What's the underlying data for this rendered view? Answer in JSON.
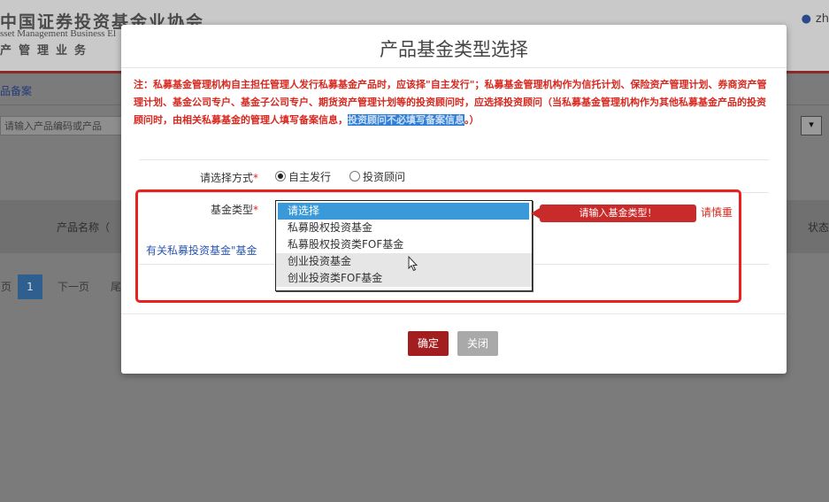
{
  "background": {
    "org_name": "中国证券投资基金业协会",
    "org_name_en": "sset Management Business El",
    "org_sub": "产管理业务",
    "user_name": "zh",
    "breadcrumb": "品备案",
    "search_placeholder": "请输入产品编码或产品",
    "select_arrow": "▾",
    "table_col_product": "产品名称（",
    "table_col_status": "状态",
    "pager": {
      "prev": "页",
      "current": "1",
      "next": "下一页",
      "last": "尾"
    }
  },
  "modal": {
    "title": "产品基金类型选择",
    "notice_text": "注：私募基金管理机构自主担任管理人发行私募基金产品时，应该择\"自主发行\"；私募基金管理机构作为信托计划、保险资产管理计划、券商资产管理计划、基金公司专户、基金子公司专户、期货资产管理计划等的投资顾问时，应选择投资顾问（当私募基金管理机构作为其他私募基金产品的投资顾问时，由相关私募基金的管理人填写备案信息，",
    "notice_highlight": "投资顾问不必填写备案信息",
    "notice_end": "。）",
    "method_label": "请选择方式",
    "required_mark": "*",
    "radio_self": "自主发行",
    "radio_advisor": "投资顾问",
    "fund_type_label": "基金类型",
    "fund_type_note": "有关私募投资基金\"基金",
    "ok_label": "确定",
    "close_label": "关闭"
  },
  "dropdown": {
    "options": [
      "请选择",
      "私募股权投资基金",
      "私募股权投资类FOF基金",
      "创业投资基金",
      "创业投资类FOF基金"
    ],
    "selected_index": 0,
    "hover_index": 3
  },
  "tooltip": {
    "message": "请输入基金类型！",
    "trailing": "请慎重"
  },
  "colors": {
    "accent_red": "#c92a2a",
    "select_blue": "#3a9ad9",
    "ok_button": "#a31f1f"
  }
}
